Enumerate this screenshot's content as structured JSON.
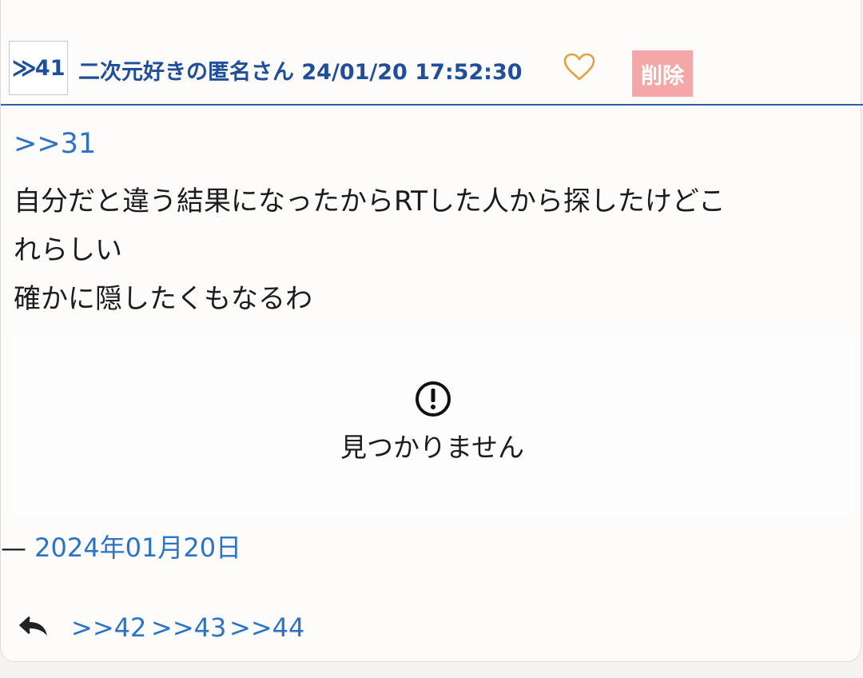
{
  "post": {
    "number_arrow": "≫",
    "number": "41",
    "poster": "二次元好きの匿名さん 24/01/20 17:52:30",
    "delete_label": "削除",
    "reply_to": ">>31",
    "body_lines": [
      "自分だと違う結果になったからRTした人から探したけどこ",
      "れらしい",
      "確かに隠したくもなるわ"
    ]
  },
  "embed": {
    "message": "見つかりません",
    "dash": "—",
    "date": "2024年01月20日"
  },
  "replies": [
    ">>42",
    ">>43",
    ">>44"
  ],
  "colors": {
    "link": "#2a73c9",
    "header_text": "#1f4e9a",
    "delete_bg": "#f5a7a7",
    "heart": "#e3a23c"
  }
}
